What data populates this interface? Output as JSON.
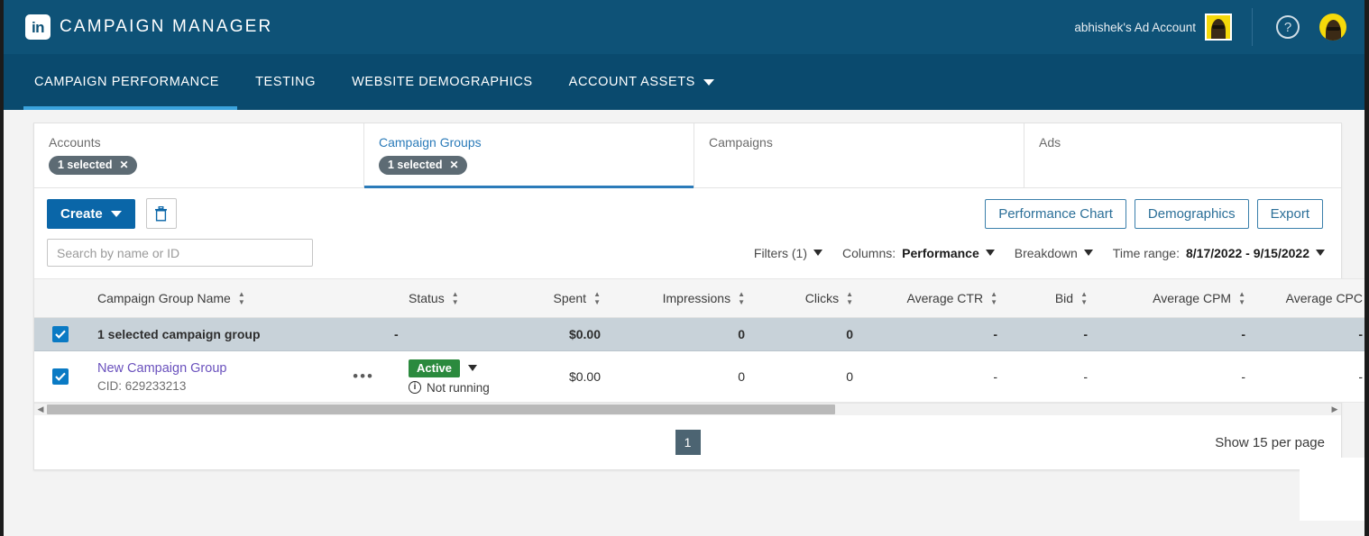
{
  "header": {
    "logo_text": "in",
    "brand": "CAMPAIGN MANAGER",
    "account_name": "abhishek's Ad Account",
    "help_icon": "?",
    "account_avatar_name": "account-avatar",
    "profile_avatar_name": "profile-avatar"
  },
  "nav": {
    "items": [
      {
        "label": "CAMPAIGN PERFORMANCE",
        "active": true
      },
      {
        "label": "TESTING",
        "active": false
      },
      {
        "label": "WEBSITE DEMOGRAPHICS",
        "active": false
      },
      {
        "label": "ACCOUNT ASSETS",
        "active": false,
        "has_caret": true
      }
    ]
  },
  "object_tabs": [
    {
      "label": "Accounts",
      "pill": "1 selected",
      "pill_close": "✕",
      "selected": false
    },
    {
      "label": "Campaign Groups",
      "pill": "1 selected",
      "pill_close": "✕",
      "selected": true
    },
    {
      "label": "Campaigns",
      "pill": null,
      "selected": false
    },
    {
      "label": "Ads",
      "pill": null,
      "selected": false
    }
  ],
  "actions": {
    "create_label": "Create",
    "delete_icon": "trash-icon",
    "performance_chart": "Performance Chart",
    "demographics": "Demographics",
    "export": "Export"
  },
  "filters": {
    "search_placeholder": "Search by name or ID",
    "search_value": "",
    "filters_label": "Filters (1)",
    "columns_prefix": "Columns:",
    "columns_value": "Performance",
    "breakdown_label": "Breakdown",
    "time_range_prefix": "Time range:",
    "time_range_value": "8/17/2022 - 9/15/2022"
  },
  "table": {
    "columns": [
      {
        "key": "name",
        "label": "Campaign Group Name",
        "sortable": true
      },
      {
        "key": "status",
        "label": "Status",
        "sortable": true
      },
      {
        "key": "spent",
        "label": "Spent",
        "sortable": true
      },
      {
        "key": "impr",
        "label": "Impressions",
        "sortable": true
      },
      {
        "key": "clicks",
        "label": "Clicks",
        "sortable": true
      },
      {
        "key": "ctr",
        "label": "Average CTR",
        "sortable": true
      },
      {
        "key": "bid",
        "label": "Bid",
        "sortable": true
      },
      {
        "key": "cpm",
        "label": "Average CPM",
        "sortable": true
      },
      {
        "key": "cpc",
        "label": "Average CPC",
        "sortable": true
      }
    ],
    "summary_row": {
      "checked": true,
      "label": "1 selected campaign group",
      "status": "-",
      "spent": "$0.00",
      "impr": "0",
      "clicks": "0",
      "ctr": "-",
      "bid": "-",
      "cpm": "-",
      "cpc": "-"
    },
    "rows": [
      {
        "checked": true,
        "name": "New Campaign Group",
        "cid": "CID: 629233213",
        "more_icon": "•••",
        "status_badge": "Active",
        "status_note": "Not running",
        "spent": "$0.00",
        "impr": "0",
        "clicks": "0",
        "ctr": "-",
        "bid": "-",
        "cpm": "-",
        "cpc": "-"
      }
    ]
  },
  "footer": {
    "page_number": "1",
    "per_page": "Show 15 per page"
  },
  "colors": {
    "header_blue": "#0e5277",
    "nav_blue": "#0a4a6e",
    "accent_blue": "#2b7bb9",
    "create_blue": "#0a66a8",
    "active_green": "#2b8a3e",
    "link_purple": "#6a51bd",
    "summary_row": "#c8d2d9"
  }
}
